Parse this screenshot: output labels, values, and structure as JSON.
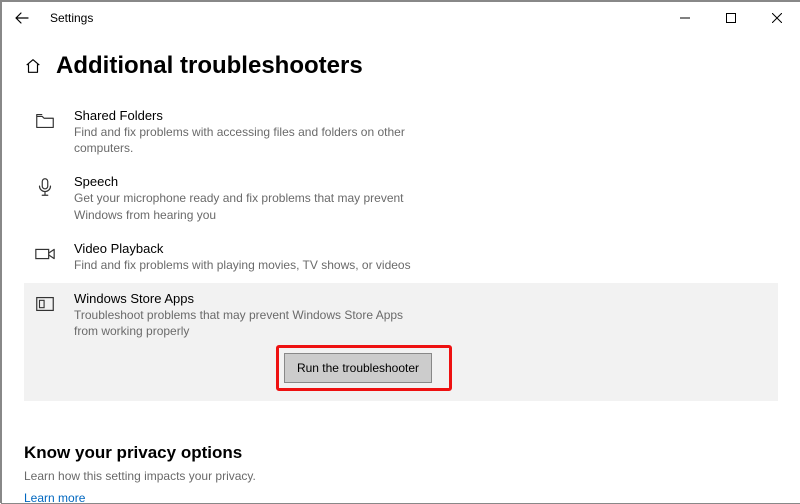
{
  "window": {
    "title": "Settings"
  },
  "page": {
    "heading": "Additional troubleshooters"
  },
  "troubleshooters": [
    {
      "key": "shared-folders",
      "title": "Shared Folders",
      "desc": "Find and fix problems with accessing files and folders on other computers.",
      "selected": false
    },
    {
      "key": "speech",
      "title": "Speech",
      "desc": "Get your microphone ready and fix problems that may prevent Windows from hearing you",
      "selected": false
    },
    {
      "key": "video-playback",
      "title": "Video Playback",
      "desc": "Find and fix problems with playing movies, TV shows, or videos",
      "selected": false
    },
    {
      "key": "windows-store-apps",
      "title": "Windows Store Apps",
      "desc": "Troubleshoot problems that may prevent Windows Store Apps from working properly",
      "selected": true,
      "run_label": "Run the troubleshooter"
    }
  ],
  "privacy": {
    "heading": "Know your privacy options",
    "desc": "Learn how this setting impacts your privacy.",
    "link": "Learn more"
  }
}
